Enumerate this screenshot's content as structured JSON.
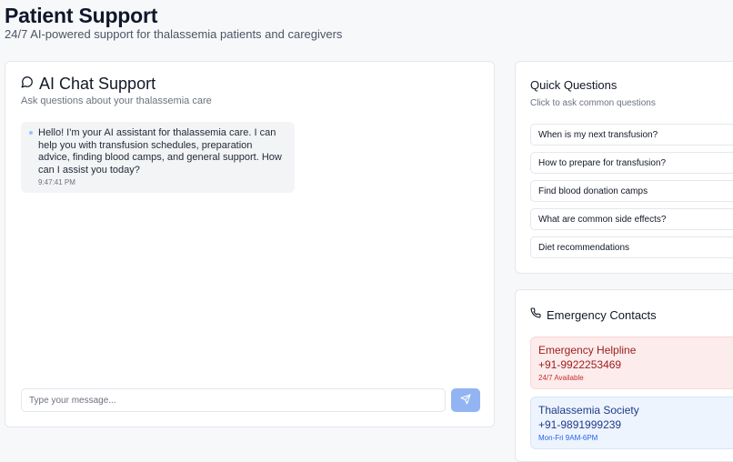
{
  "header": {
    "title": "Patient Support",
    "subtitle": "24/7 AI-powered support for thalassemia patients and caregivers"
  },
  "chat": {
    "icon": "message-circle-icon",
    "title": "AI Chat Support",
    "subtitle": "Ask questions about your thalassemia care",
    "messages": [
      {
        "sender": "assistant",
        "text": "Hello! I'm your AI assistant for thalassemia care. I can help you with transfusion schedules, preparation advice, finding blood camps, and general support. How can I assist you today?",
        "time": "9:47:41 PM"
      }
    ],
    "input": {
      "placeholder": "Type your message...",
      "value": ""
    },
    "send_icon": "send-icon",
    "send_color": "#93b4f2"
  },
  "quick": {
    "title": "Quick Questions",
    "subtitle": "Click to ask common questions",
    "items": [
      "When is my next transfusion?",
      "How to prepare for transfusion?",
      "Find blood donation camps",
      "What are common side effects?",
      "Diet recommendations"
    ]
  },
  "emergency": {
    "icon": "phone-icon",
    "title": "Emergency Contacts",
    "contacts": [
      {
        "name": "Emergency Helpline",
        "phone": "+91-9922253469",
        "hours": "24/7 Available",
        "color": "#9b1c1c"
      },
      {
        "name": "Thalassemia Society",
        "phone": "+91-9891999239",
        "hours": "Mon-Fri 9AM-6PM",
        "color": "#1e3a8a"
      }
    ]
  }
}
